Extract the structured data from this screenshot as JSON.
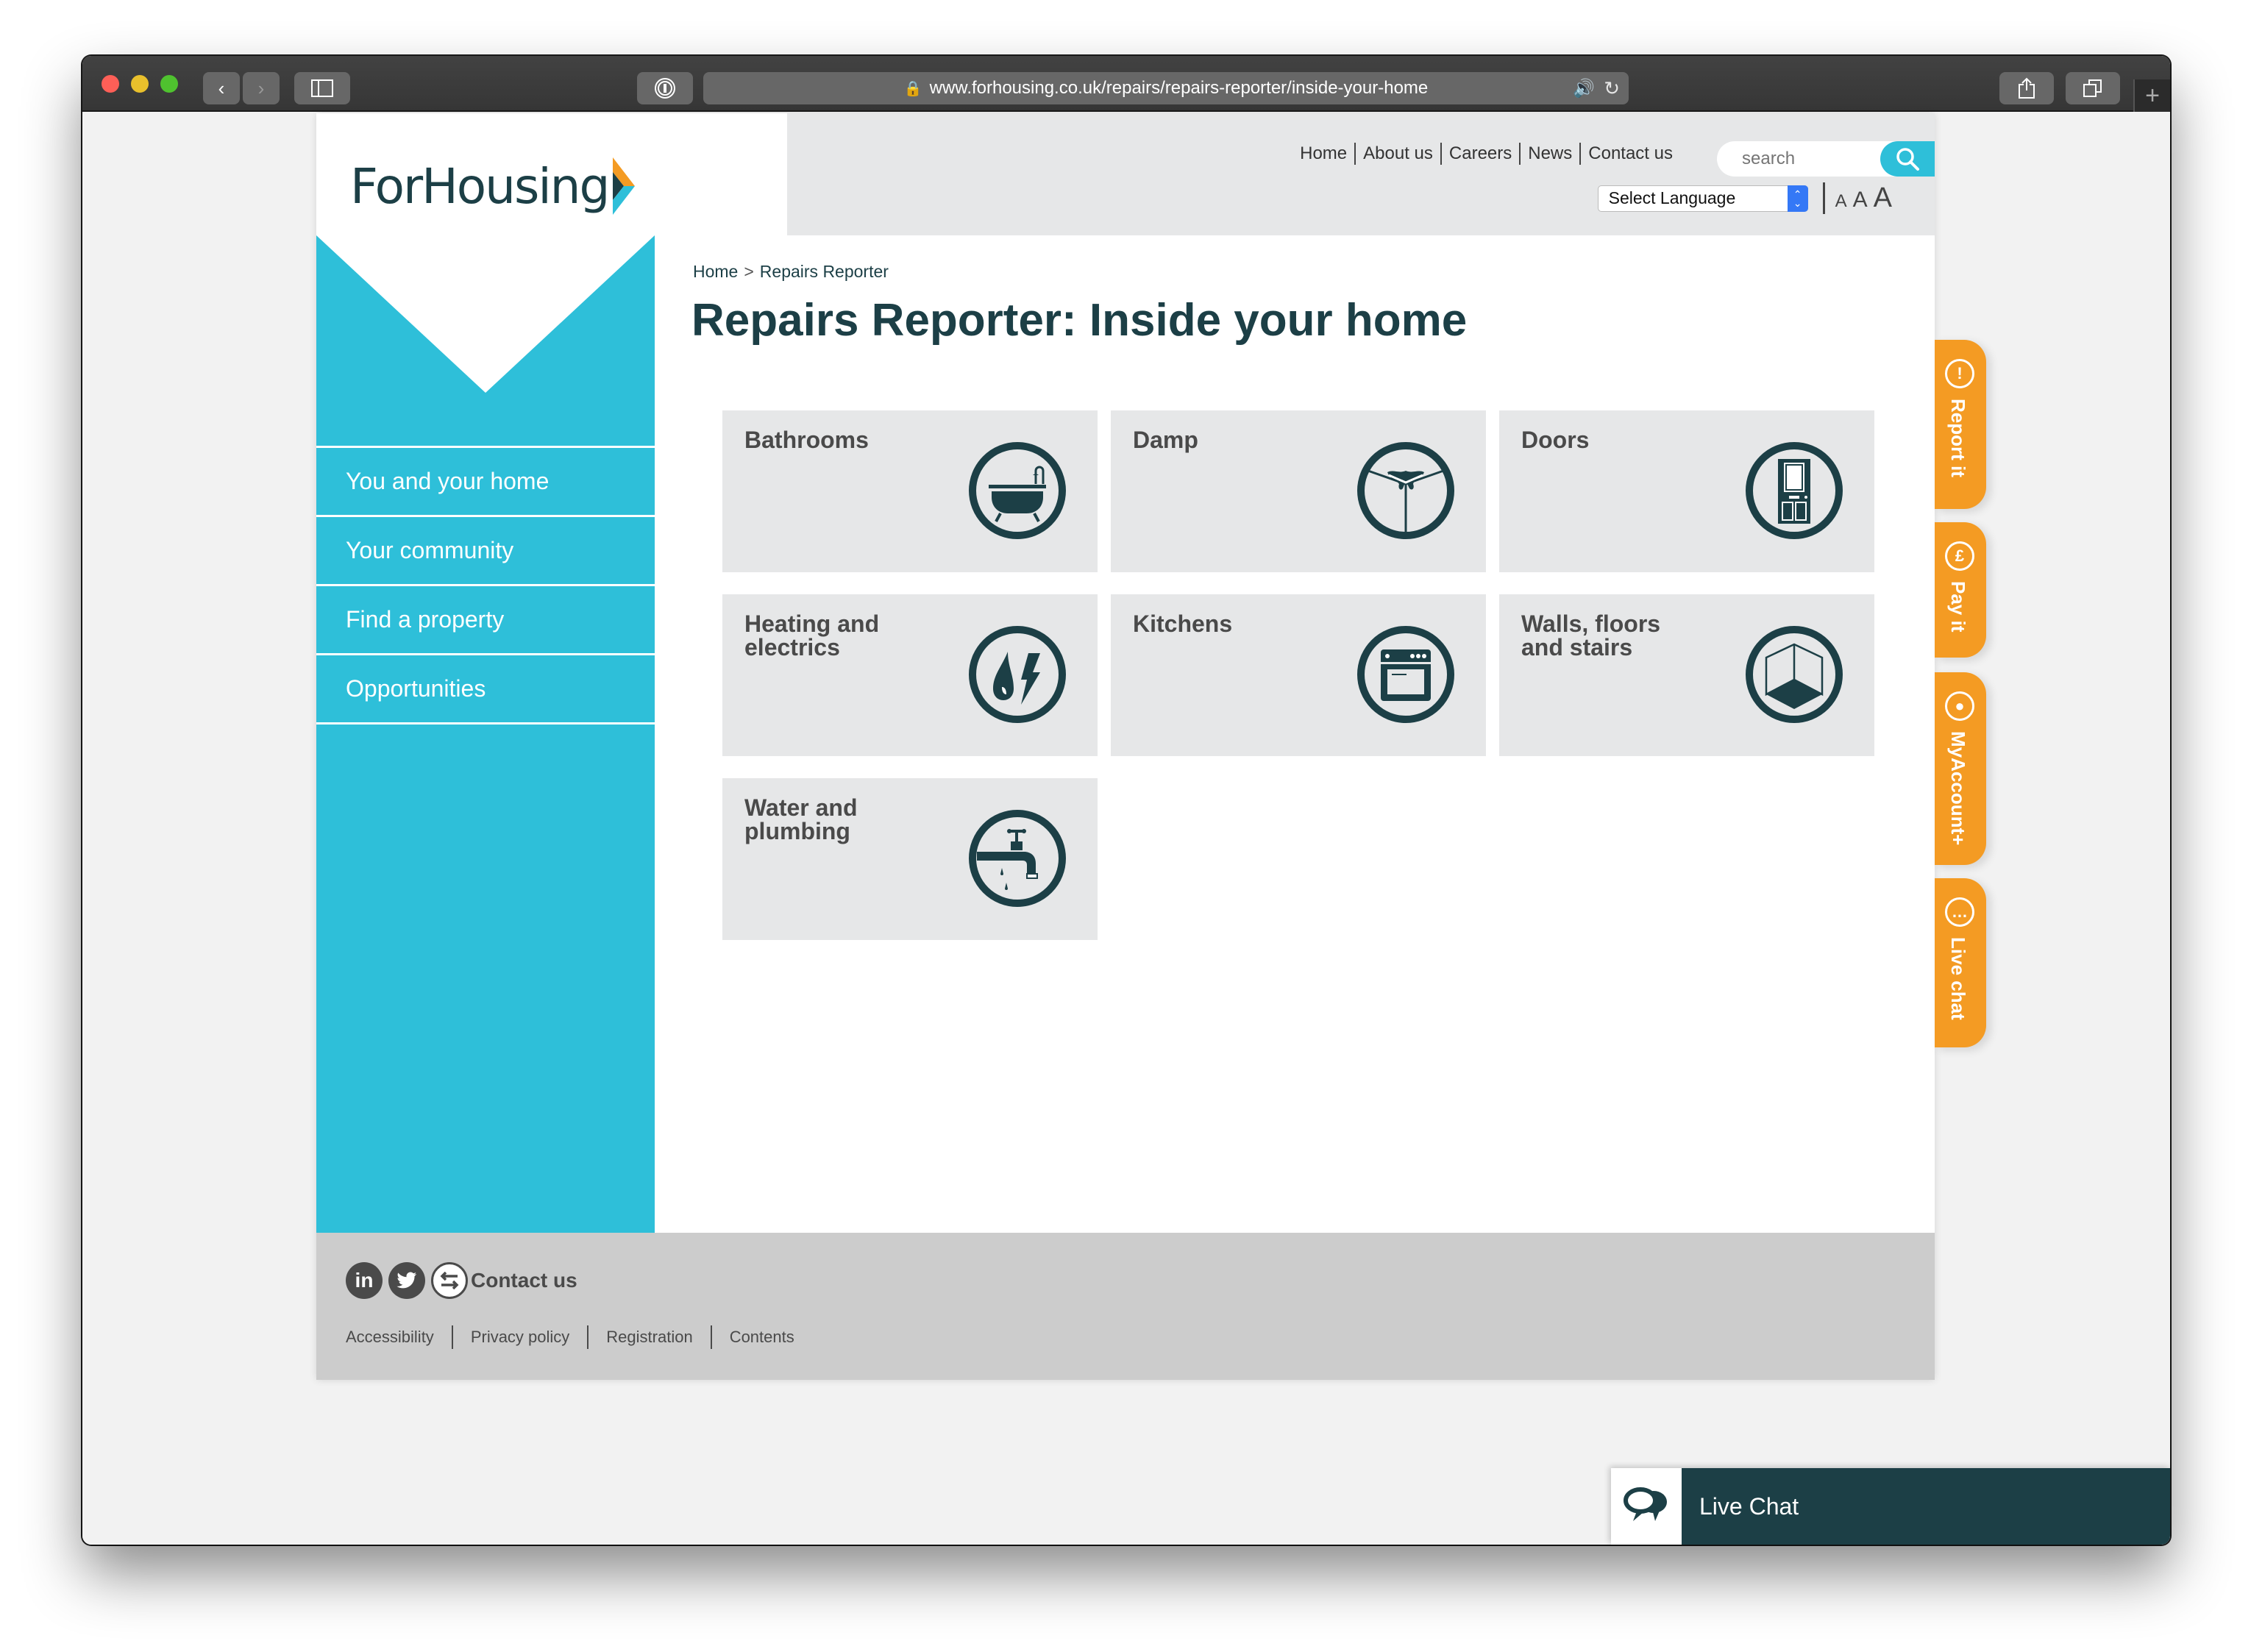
{
  "browser": {
    "url": "www.forhousing.co.uk/repairs/repairs-reporter/inside-your-home",
    "icons": [
      "back-icon",
      "forward-icon",
      "sidebar-icon",
      "password-icon",
      "lock-icon",
      "audio-icon",
      "reload-icon",
      "share-icon",
      "tabs-icon",
      "new-tab-icon"
    ]
  },
  "header": {
    "logo_text": "ForHousing",
    "top_nav": [
      "Home",
      "About us",
      "Careers",
      "News",
      "Contact us"
    ],
    "search_placeholder": "search",
    "language_select": "Select Language",
    "font_sizes": [
      "A",
      "A",
      "A"
    ]
  },
  "sidebar": {
    "items": [
      {
        "label": "You and your home"
      },
      {
        "label": "Your community"
      },
      {
        "label": "Find a property"
      },
      {
        "label": "Opportunities"
      }
    ]
  },
  "main": {
    "breadcrumb": {
      "home": "Home",
      "separator": ">",
      "current": "Repairs Reporter"
    },
    "title": "Repairs Reporter: Inside your home",
    "tiles": [
      {
        "label": "Bathrooms",
        "icon": "bath-icon"
      },
      {
        "label": "Damp",
        "icon": "damp-icon"
      },
      {
        "label": "Doors",
        "icon": "door-icon"
      },
      {
        "label": "Heating and electrics",
        "icon": "flame-bolt-icon"
      },
      {
        "label": "Kitchens",
        "icon": "oven-icon"
      },
      {
        "label": "Walls, floors and stairs",
        "icon": "cube-icon"
      },
      {
        "label": "Water and plumbing",
        "icon": "tap-icon"
      }
    ]
  },
  "footer": {
    "contact_label": "Contact us",
    "social": [
      "linkedin-icon",
      "twitter-icon",
      "contact-icon"
    ],
    "links": [
      "Accessibility",
      "Privacy policy",
      "Registration",
      "Contents"
    ]
  },
  "side_tabs": [
    {
      "label": "Report it",
      "glyph": "!"
    },
    {
      "label": "Pay it",
      "glyph": "£"
    },
    {
      "label": "MyAccount+",
      "glyph": "●"
    },
    {
      "label": "Live chat",
      "glyph": "…"
    }
  ],
  "live_chat": {
    "label": "Live Chat"
  },
  "colors": {
    "brand_teal": "#1c3f46",
    "accent_cyan": "#2ebfd9",
    "accent_orange": "#f49b23",
    "tile_grey": "#e6e7e8",
    "footer_grey": "#cccccc"
  }
}
